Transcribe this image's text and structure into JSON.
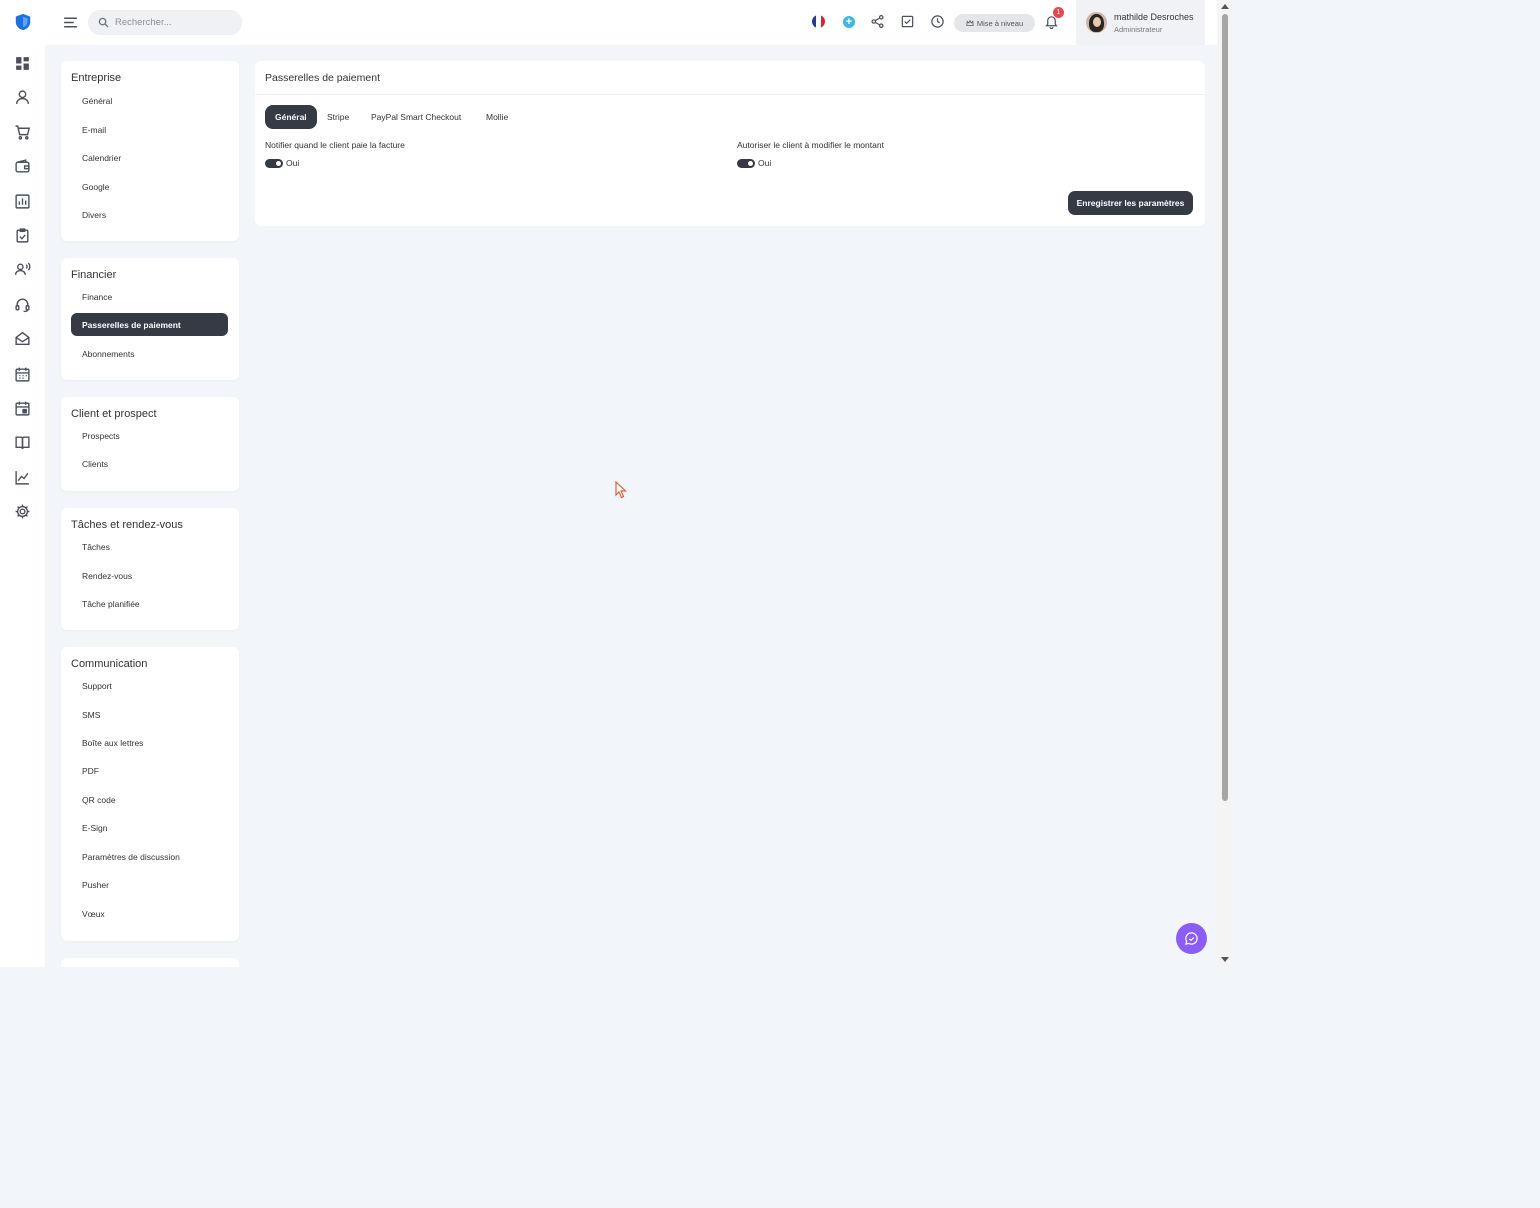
{
  "search": {
    "placeholder": "Rechercher..."
  },
  "topbar": {
    "upgrade_label": "Mise à niveau",
    "notification_count": "1",
    "user_name": "mathilde Desroches",
    "user_role": "Administrateur"
  },
  "rail": {
    "icons": [
      "dashboard-icon",
      "user-icon",
      "cart-icon",
      "wallet-icon",
      "reports-icon",
      "clipboard-check-icon",
      "users-wave-icon",
      "headset-icon",
      "mail-open-icon",
      "calendar-icon",
      "calendar-event-icon",
      "book-icon",
      "chart-line-icon",
      "gear-icon"
    ]
  },
  "sidebar": {
    "groups": [
      {
        "title": "Entreprise",
        "items": [
          "Général",
          "E-mail",
          "Calendrier",
          "Google",
          "Divers"
        ]
      },
      {
        "title": "Financier",
        "items": [
          "Finance",
          "Passerelles de paiement",
          "Abonnements"
        ]
      },
      {
        "title": "Client et prospect",
        "items": [
          "Prospects",
          "Clients"
        ]
      },
      {
        "title": "Tâches et rendez-vous",
        "items": [
          "Tâches",
          "Rendez-vous",
          "Tâche planifiée"
        ]
      },
      {
        "title": "Communication",
        "items": [
          "Support",
          "SMS",
          "Boîte aux lettres",
          "PDF",
          "QR code",
          "E-Sign",
          "Paramètres de discussion",
          "Pusher",
          "Vœux"
        ]
      }
    ],
    "active_item": "Passerelles de paiement"
  },
  "main": {
    "title": "Passerelles de paiement",
    "tabs": [
      "Général",
      "Stripe",
      "PayPal Smart Checkout",
      "Mollie"
    ],
    "active_tab": "Général",
    "fields": [
      {
        "label": "Notifier quand le client paie la facture",
        "value_label": "Oui",
        "enabled": true
      },
      {
        "label": "Autoriser le client à modifier le montant",
        "value_label": "Oui",
        "enabled": true
      }
    ],
    "save_label": "Enregistrer les paramètres"
  },
  "colors": {
    "dark": "#353a45",
    "accent_chat": "#8b5cf6",
    "badge": "#e5484d",
    "plus": "#3fb7e5",
    "background": "#f2f5f9"
  }
}
